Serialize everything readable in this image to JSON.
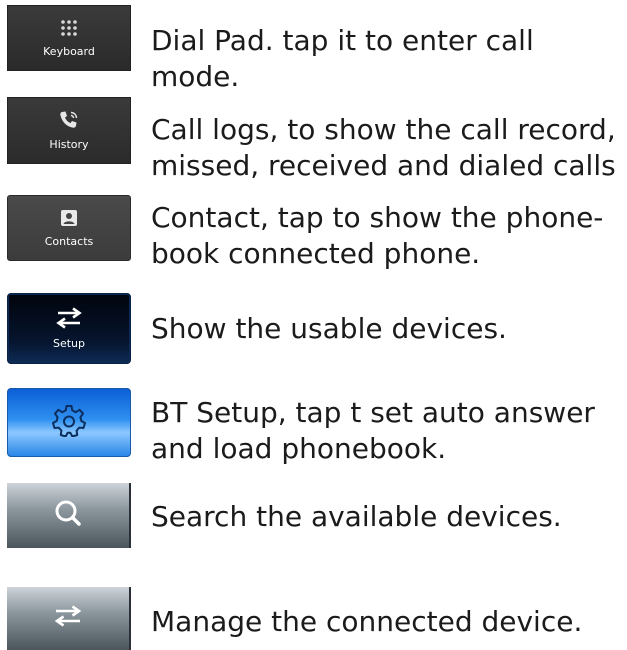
{
  "items": [
    {
      "button_label": "Keyboard",
      "icon": "dialpad-icon",
      "description": "Dial Pad. tap it to enter call mode."
    },
    {
      "button_label": "History",
      "icon": "phone-call-icon",
      "description": "Call logs, to show the call record, missed, received and dialed calls"
    },
    {
      "button_label": "Contacts",
      "icon": "contact-card-icon",
      "description": "Contact, tap to show the phone-book connected phone."
    },
    {
      "button_label": "Setup",
      "icon": "swap-arrows-icon",
      "description": "Show the usable devices."
    },
    {
      "button_label": "",
      "icon": "gear-icon",
      "description": "BT Setup, tap t set auto answer and load phonebook."
    },
    {
      "button_label": "",
      "icon": "search-icon",
      "description": "Search the available devices."
    },
    {
      "button_label": "",
      "icon": "swap-arrows-icon",
      "description": "Manage the connected device."
    }
  ]
}
